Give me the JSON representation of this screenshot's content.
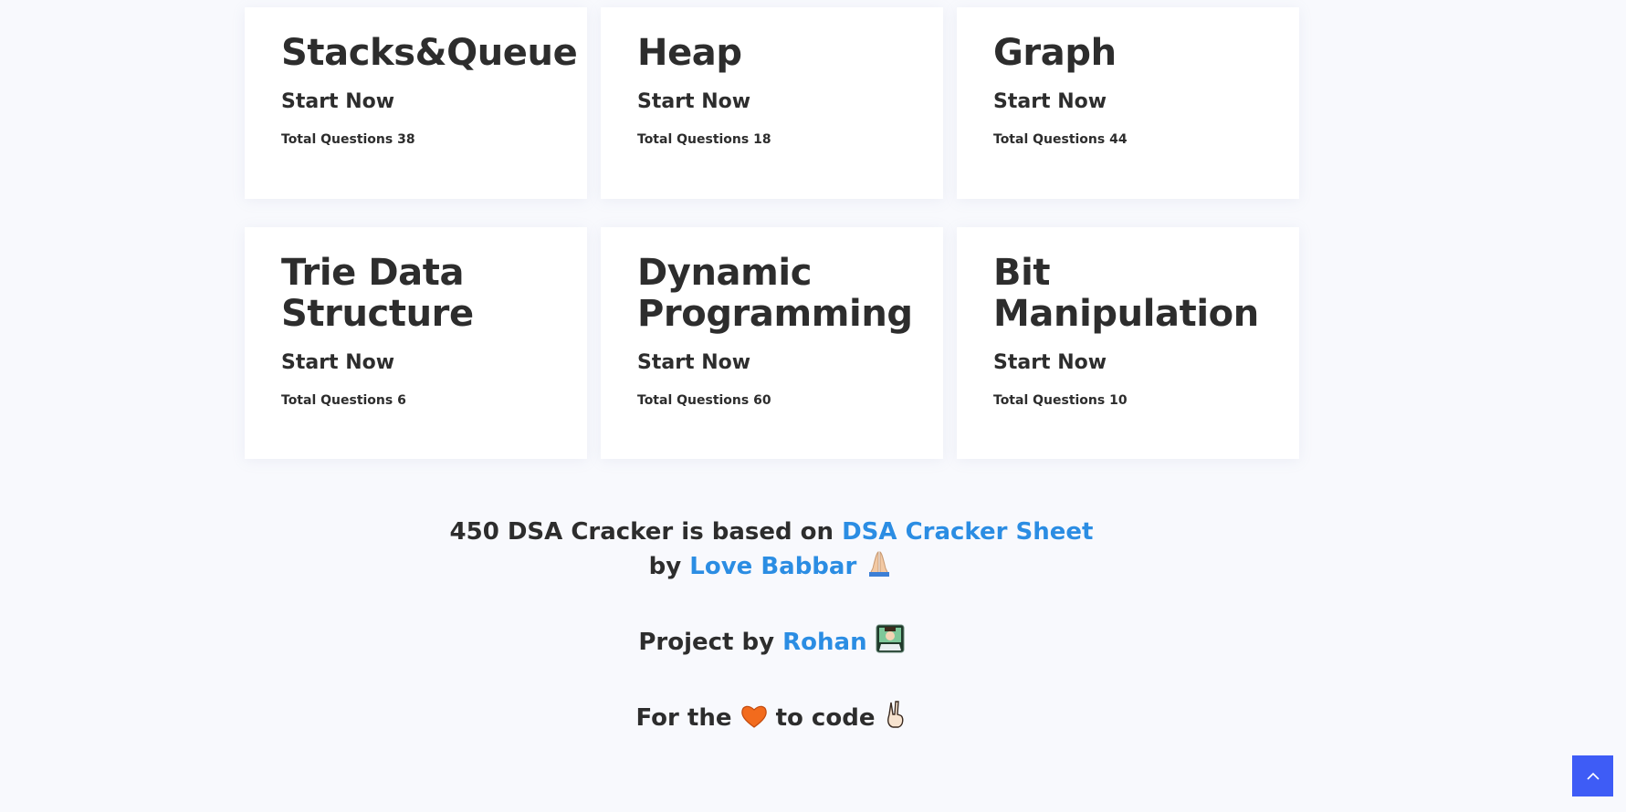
{
  "cards": [
    {
      "title": "Stacks&Queue",
      "start": "Start Now",
      "total": "Total Questions 38"
    },
    {
      "title": "Heap",
      "start": "Start Now",
      "total": "Total Questions 18"
    },
    {
      "title": "Graph",
      "start": "Start Now",
      "total": "Total Questions 44"
    },
    {
      "title": "Trie Data Structure",
      "start": "Start Now",
      "total": "Total Questions 6"
    },
    {
      "title": "Dynamic Programming",
      "start": "Start Now",
      "total": "Total Questions 60"
    },
    {
      "title": "Bit Manipulation",
      "start": "Start Now",
      "total": "Total Questions 10"
    }
  ],
  "footer": {
    "based_prefix": "450 DSA Cracker is based on",
    "sheet_link": "DSA Cracker Sheet",
    "by": "by",
    "author_link": "Love Babbar",
    "project_prefix": "Project by",
    "project_author": "Rohan",
    "love_prefix": "For the",
    "love_suffix": "to code"
  },
  "icons": {
    "praying_hands": "praying-hands-icon",
    "developer": "technologist-icon",
    "heart": "orange-heart-icon",
    "victory": "victory-hand-icon",
    "scroll_top": "chevron-up-icon"
  },
  "colors": {
    "link": "#2b8de3",
    "scroll_button": "#3e5cf6",
    "heart": "#f26b1d"
  }
}
